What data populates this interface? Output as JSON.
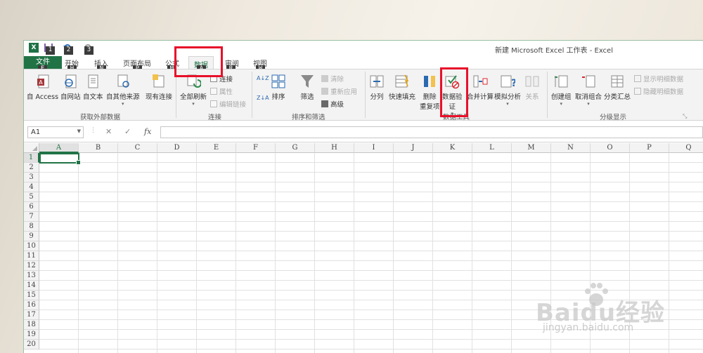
{
  "window": {
    "title": "新建 Microsoft Excel 工作表 - Excel"
  },
  "keytips": {
    "k1": "1",
    "k2": "2",
    "k3": "3",
    "kF": "F",
    "kH": "H",
    "kN": "N",
    "kP": "P",
    "kM": "M",
    "kA": "A",
    "kR": "R",
    "kW": "W"
  },
  "tabs": {
    "file": "文件",
    "home": "开始",
    "insert": "插入",
    "layout": "页面布局",
    "formula": "公式",
    "data": "数据",
    "review": "审阅",
    "view": "视图"
  },
  "ribbon": {
    "access": "自 Access",
    "web": "自网站",
    "text": "自文本",
    "other": "自其他来源",
    "existing": "现有连接",
    "refresh_all": "全部刷新",
    "connections": "连接",
    "properties": "属性",
    "edit_links": "编辑链接",
    "sort": "排序",
    "filter": "筛选",
    "clear": "清除",
    "reapply": "重新应用",
    "advanced": "高级",
    "text_to_columns": "分列",
    "flash_fill": "快速填充",
    "remove_dup_1": "删除",
    "remove_dup_2": "重复项",
    "data_validation_1": "数据验",
    "data_validation_2": "证",
    "consolidate": "合并计算",
    "whatif": "模拟分析",
    "relationships": "关系",
    "group": "创建组",
    "ungroup": "取消组合",
    "subtotal": "分类汇总",
    "show_detail": "显示明细数据",
    "hide_detail": "隐藏明细数据",
    "group_get_external": "获取外部数据",
    "group_connections": "连接",
    "group_sort_filter": "排序和筛选",
    "group_data_tools": "数据工具",
    "group_outline": "分级显示"
  },
  "formula_bar": {
    "name_box": "A1",
    "fx": "fx",
    "value": ""
  },
  "sheet": {
    "columns": [
      "A",
      "B",
      "C",
      "D",
      "E",
      "F",
      "G",
      "H",
      "I",
      "J",
      "K",
      "L",
      "M",
      "N",
      "O",
      "P",
      "Q"
    ],
    "rows": [
      "1",
      "2",
      "3",
      "4",
      "5",
      "6",
      "7",
      "8",
      "9",
      "10",
      "11",
      "12",
      "13",
      "14",
      "15",
      "16",
      "17",
      "18",
      "19",
      "20"
    ]
  },
  "watermark": {
    "brand": "Baidu经验",
    "url": "jingyan.baidu.com"
  },
  "colors": {
    "excel_green": "#217346",
    "highlight_red": "#e8102a"
  }
}
